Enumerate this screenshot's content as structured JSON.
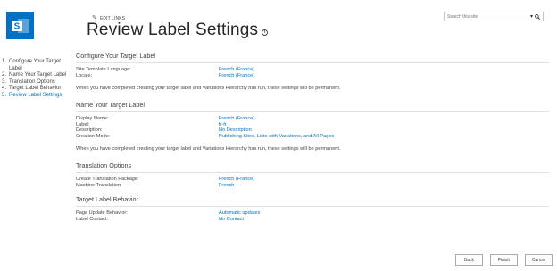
{
  "header": {
    "edit_links": "EDIT LINKS",
    "page_title": "Review Label Settings",
    "search_placeholder": "Search this site"
  },
  "quick_launch": [
    {
      "num": "1.",
      "label": "Configure Your Target Label",
      "active": false
    },
    {
      "num": "2.",
      "label": "Name Your Target Label",
      "active": false
    },
    {
      "num": "3.",
      "label": "Translation Options",
      "active": false
    },
    {
      "num": "4.",
      "label": "Target Label Behavior",
      "active": false
    },
    {
      "num": "5.",
      "label": "Review Label Settings",
      "active": true
    }
  ],
  "sections": {
    "configure": {
      "title": "Configure Your Target Label",
      "rows": [
        {
          "label": "Site Template Language:",
          "value": "French (France)"
        },
        {
          "label": "Locale:",
          "value": "French (France)"
        }
      ],
      "note": "When you have completed creating your target label and Variations Hierarchy has run, these settings will be permanent."
    },
    "name": {
      "title": "Name Your Target Label",
      "rows": [
        {
          "label": "Display Name:",
          "value": "French (France)"
        },
        {
          "label": "Label:",
          "value": "fr-fr"
        },
        {
          "label": "Description:",
          "value": "No Description"
        },
        {
          "label": "Creation Mode:",
          "value": "Publishing Sites, Lists with Variations, and All Pages"
        }
      ],
      "note": "When you have completed creating your target label and Variations Hierarchy has run, these settings will be permanent."
    },
    "translation": {
      "title": "Translation Options",
      "rows": [
        {
          "label": "Create Translation Package:",
          "value": "French (France)"
        },
        {
          "label": "Machine Translation:",
          "value": "French"
        }
      ]
    },
    "behavior": {
      "title": "Target Label Behavior",
      "rows": [
        {
          "label": "Page Update Behavior:",
          "value": "Automatic updates"
        },
        {
          "label": "Label Contact:",
          "value": "No Contact"
        }
      ]
    }
  },
  "buttons": {
    "back": "Back",
    "finish": "Finish",
    "cancel": "Cancel"
  },
  "colors": {
    "accent": "#0072c6",
    "text": "#444444",
    "title": "#262626"
  }
}
